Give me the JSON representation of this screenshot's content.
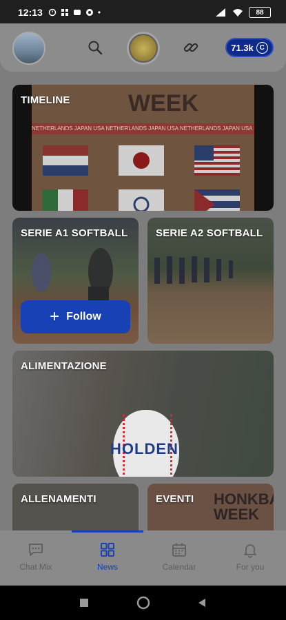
{
  "status_bar": {
    "time": "12:13",
    "battery": "88"
  },
  "header": {
    "coins": "71.3k",
    "coin_symbol": "C"
  },
  "cards": {
    "timeline": {
      "title": "TIMELINE",
      "poster_word": "WEEK",
      "poster_strip": "NETHERLANDS JAPAN USA NETHERLANDS JAPAN USA NETHERLANDS JAPAN USA NETHERLANDS"
    },
    "serie_a1": {
      "title": "SERIE A1 SOFTBALL",
      "follow_label": "Follow"
    },
    "serie_a2": {
      "title": "SERIE A2 SOFTBALL"
    },
    "alimentazione": {
      "title": "ALIMENTAZIONE",
      "ball_text": "HOLDEN"
    },
    "allenamenti": {
      "title": "ALLENAMENTI"
    },
    "eventi": {
      "title": "EVENTI",
      "poster_line1": "HONKBAL",
      "poster_line2": "WEEK"
    }
  },
  "bottom_nav": {
    "items": [
      {
        "label": "Chat Mix",
        "icon": "chat-icon"
      },
      {
        "label": "News",
        "icon": "grid-icon",
        "active": true
      },
      {
        "label": "Calendar",
        "icon": "calendar-icon"
      },
      {
        "label": "For you",
        "icon": "bell-icon"
      }
    ]
  },
  "colors": {
    "accent": "#1741b4",
    "coin_bg": "#0e2a8a"
  }
}
